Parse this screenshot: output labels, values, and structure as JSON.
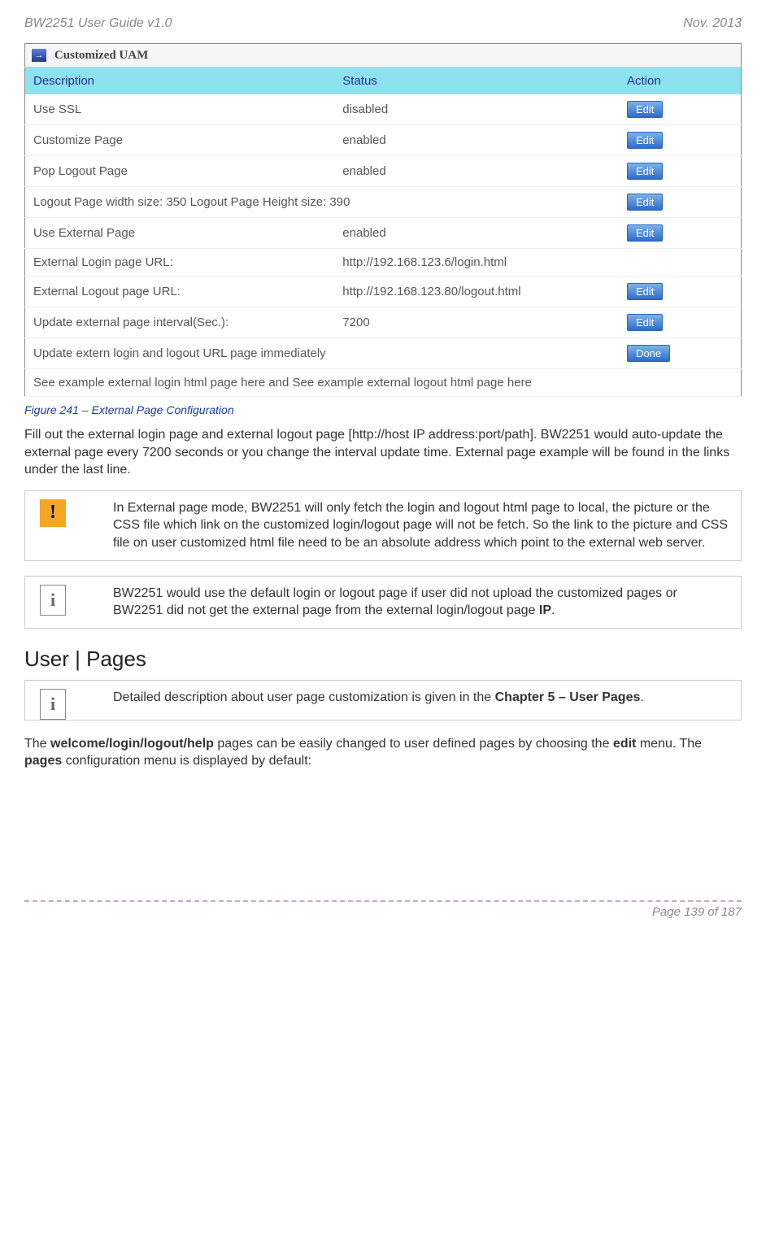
{
  "header": {
    "left": "BW2251 User Guide v1.0",
    "right": "Nov.  2013"
  },
  "panel": {
    "title": "Customized UAM",
    "columns": [
      "Description",
      "Status",
      "Action"
    ],
    "rows": [
      {
        "desc": "Use SSL",
        "status": "disabled",
        "action": "Edit"
      },
      {
        "desc": "Customize Page",
        "status": "enabled",
        "action": "Edit"
      },
      {
        "desc": "Pop Logout Page",
        "status": "enabled",
        "action": "Edit"
      },
      {
        "desc": "Logout Page width size: 350  Logout Page Height size: 390",
        "status": "",
        "action": "Edit",
        "span": true
      },
      {
        "desc": "Use External Page",
        "status": "enabled",
        "action": "Edit"
      },
      {
        "desc": "External Login page URL:",
        "status": "http://192.168.123.6/login.html",
        "action": ""
      },
      {
        "desc": "External Logout page URL:",
        "status": "http://192.168.123.80/logout.html",
        "action": "Edit"
      },
      {
        "desc": "Update external page interval(Sec.):",
        "status": "7200",
        "action": "Edit"
      },
      {
        "desc": "Update extern login and logout URL page immediately",
        "status": "",
        "action": "Done",
        "span": true
      }
    ],
    "footerLink": "See example external login html page here and See example external logout html page here"
  },
  "figureCaption": "Figure 241 – External Page Configuration",
  "para1": "Fill out the external login page and external logout page [http://host IP address:port/path]. BW2251 would auto-update the external page every 7200 seconds or you change the interval update time. External page example will be found in the links under the last line.",
  "warnNote": "In External page mode, BW2251 will only fetch the login and logout html page to local, the picture or the CSS file which link on the customized login/logout page will not be fetch. So the link to the picture and CSS file on user customized html file need to be an absolute address which point to the external web server.",
  "infoNote1_a": "BW2251 would use the default login or logout page if user did not upload the customized pages or BW2251 did not get the external page from the external login/logout page ",
  "infoNote1_b": "IP",
  "infoNote1_c": ".",
  "sectionTitle": "User | Pages",
  "infoNote2_a": "Detailed description about user page customization is given in the ",
  "infoNote2_b": "Chapter 5 – User Pages",
  "infoNote2_c": ".",
  "para2_a": "The ",
  "para2_b": "welcome/login/logout/help",
  "para2_c": " pages can be easily changed to user defined pages by choosing the ",
  "para2_d": "edit",
  "para2_e": " menu. The ",
  "para2_f": "pages",
  "para2_g": " configuration menu is displayed by default:",
  "footer": "Page 139 of 187"
}
